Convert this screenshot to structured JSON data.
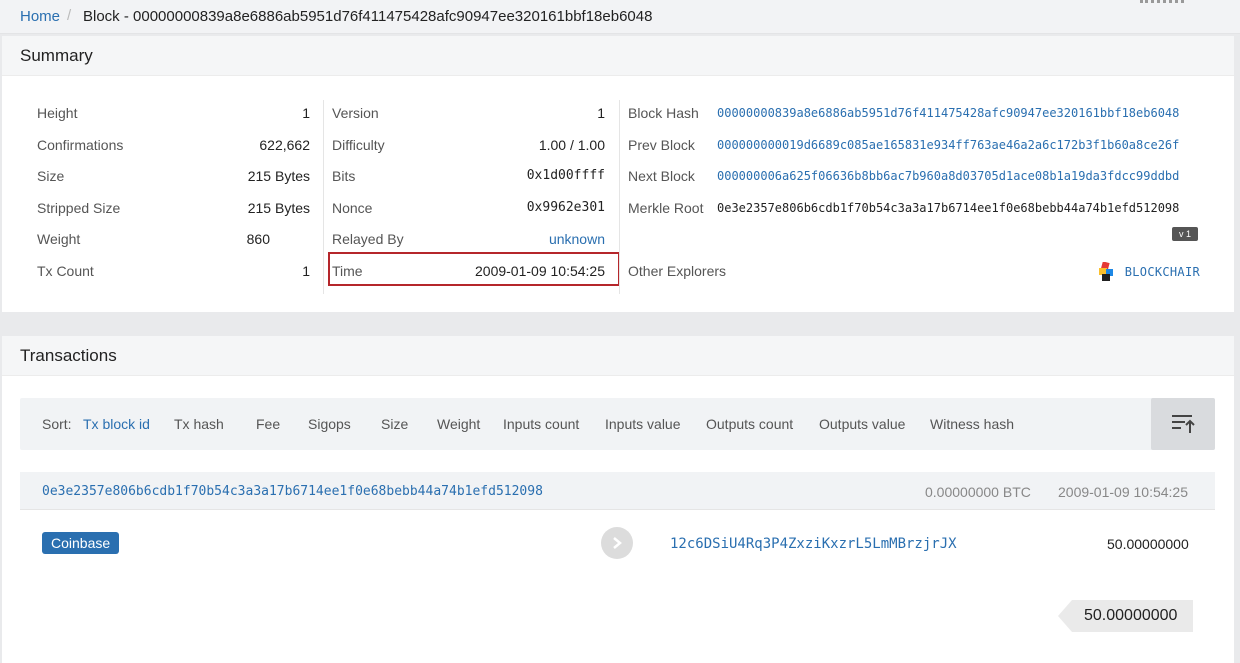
{
  "breadcrumb": {
    "home": "Home",
    "current": "Block - 00000000839a8e6886ab5951d76f411475428afc90947ee320161bbf18eb6048"
  },
  "summary": {
    "title": "Summary",
    "col1": [
      {
        "key": "Height",
        "value": "1"
      },
      {
        "key": "Confirmations",
        "value": "622,662"
      },
      {
        "key": "Size",
        "value": "215 Bytes"
      },
      {
        "key": "Stripped Size",
        "value": "215 Bytes"
      },
      {
        "key": "Weight",
        "value": "860"
      },
      {
        "key": "Tx Count",
        "value": "1"
      }
    ],
    "col2": [
      {
        "key": "Version",
        "value": "1"
      },
      {
        "key": "Difficulty",
        "value": "1.00 / 1.00"
      },
      {
        "key": "Bits",
        "value": "0x1d00ffff"
      },
      {
        "key": "Nonce",
        "value": "0x9962e301"
      },
      {
        "key": "Relayed By",
        "value": "unknown"
      },
      {
        "key": "Time",
        "value": "2009-01-09 10:54:25"
      }
    ],
    "col3": [
      {
        "key": "Block Hash",
        "value": "00000000839a8e6886ab5951d76f411475428afc90947ee320161bbf18eb6048"
      },
      {
        "key": "Prev Block",
        "value": "000000000019d6689c085ae165831e934ff763ae46a2a6c172b3f1b60a8ce26f"
      },
      {
        "key": "Next Block",
        "value": "000000006a625f06636b8bb6ac7b960a8d03705d1ace08b1a19da3fdcc99ddbd"
      },
      {
        "key": "Merkle Root",
        "value": "0e3e2357e806b6cdb1f70b54c3a3a17b6714ee1f0e68bebb44a74b1efd512098"
      }
    ],
    "version_badge": "v 1",
    "other_explorers": {
      "label": "Other Explorers",
      "link": "BLOCKCHAIR"
    }
  },
  "transactions": {
    "title": "Transactions",
    "sort_label": "Sort:",
    "sort_options": [
      "Tx block id",
      "Tx hash",
      "Fee",
      "Sigops",
      "Size",
      "Weight",
      "Inputs count",
      "Inputs value",
      "Outputs count",
      "Outputs value",
      "Witness hash"
    ],
    "items": [
      {
        "hash": "0e3e2357e806b6cdb1f70b54c3a3a17b6714ee1f0e68bebb44a74b1efd512098",
        "fee": "0.00000000 BTC",
        "time": "2009-01-09 10:54:25",
        "input": "Coinbase",
        "output_address": "12c6DSiU4Rq3P4ZxziKxzrL5LmMBrzjrJX",
        "output_amount": "50.00000000",
        "total": "50.00000000"
      }
    ]
  },
  "colors": {
    "link": "#2a6fb0",
    "highlight": "#b5262b",
    "coinbase": "#2a6fb0"
  }
}
